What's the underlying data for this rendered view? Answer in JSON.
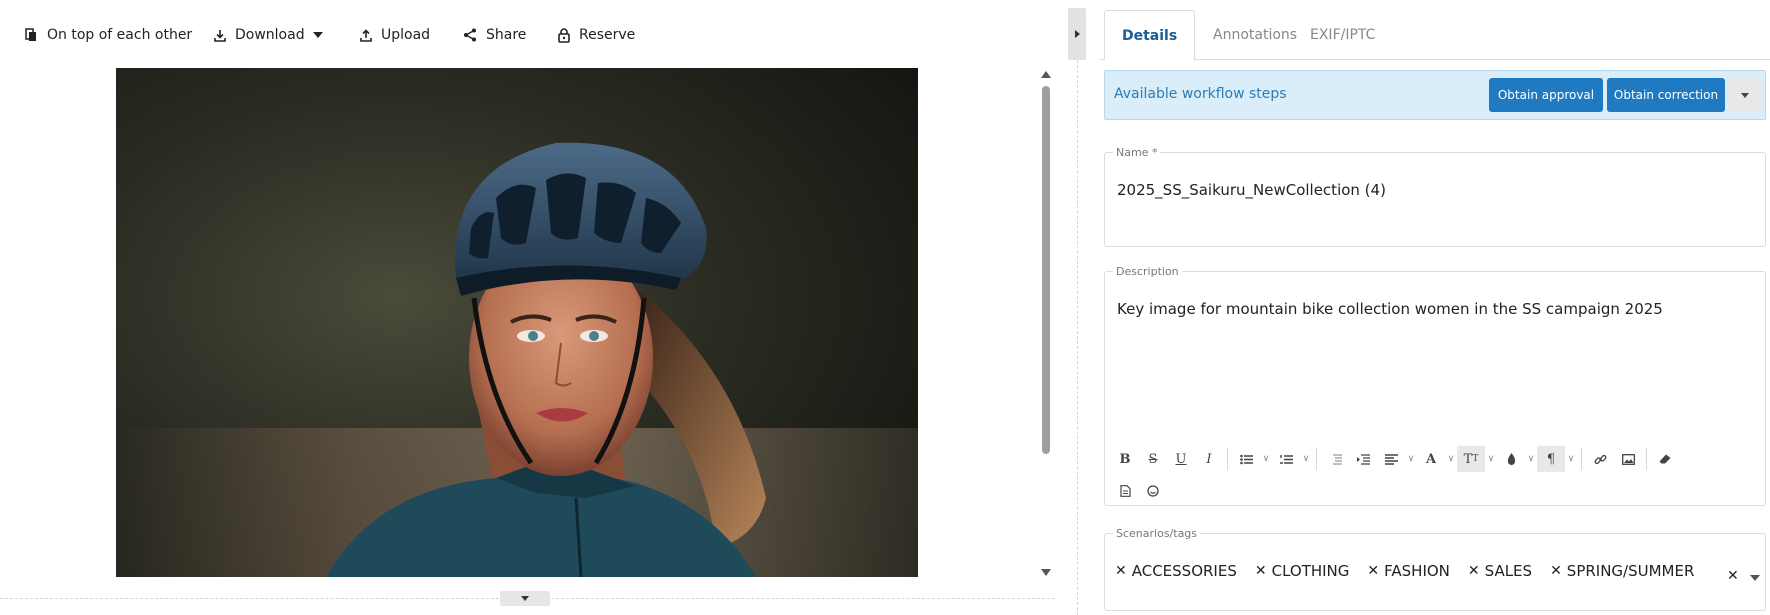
{
  "toolbar": {
    "view_mode_label": "On top of each other",
    "download_label": "Download",
    "upload_label": "Upload",
    "share_label": "Share",
    "reserve_label": "Reserve"
  },
  "tabs": [
    {
      "label": "Details",
      "active": true
    },
    {
      "label": "Annotations",
      "active": false
    },
    {
      "label": "EXIF/IPTC",
      "active": false
    }
  ],
  "workflow": {
    "label": "Available workflow steps",
    "buttons": [
      "Obtain approval",
      "Obtain correction"
    ]
  },
  "fields": {
    "name": {
      "label": "Name *",
      "value": "2025_SS_Saikuru_NewCollection (4)"
    },
    "description": {
      "label": "Description",
      "value": "Key image for mountain bike collection women in the SS campaign 2025"
    },
    "tags": {
      "label": "Scenarios/tags",
      "items": [
        "ACCESSORIES",
        "CLOTHING",
        "FASHION",
        "SALES",
        "SPRING/SUMMER"
      ]
    }
  },
  "colors": {
    "accent": "#1f7ac2",
    "workflow_bg": "#d9eef8",
    "tab_active": "#1a5c97"
  },
  "icons": {
    "view_mode": "layers-icon",
    "download": "download-icon",
    "upload": "upload-icon",
    "share": "share-icon",
    "reserve": "lock-icon"
  }
}
